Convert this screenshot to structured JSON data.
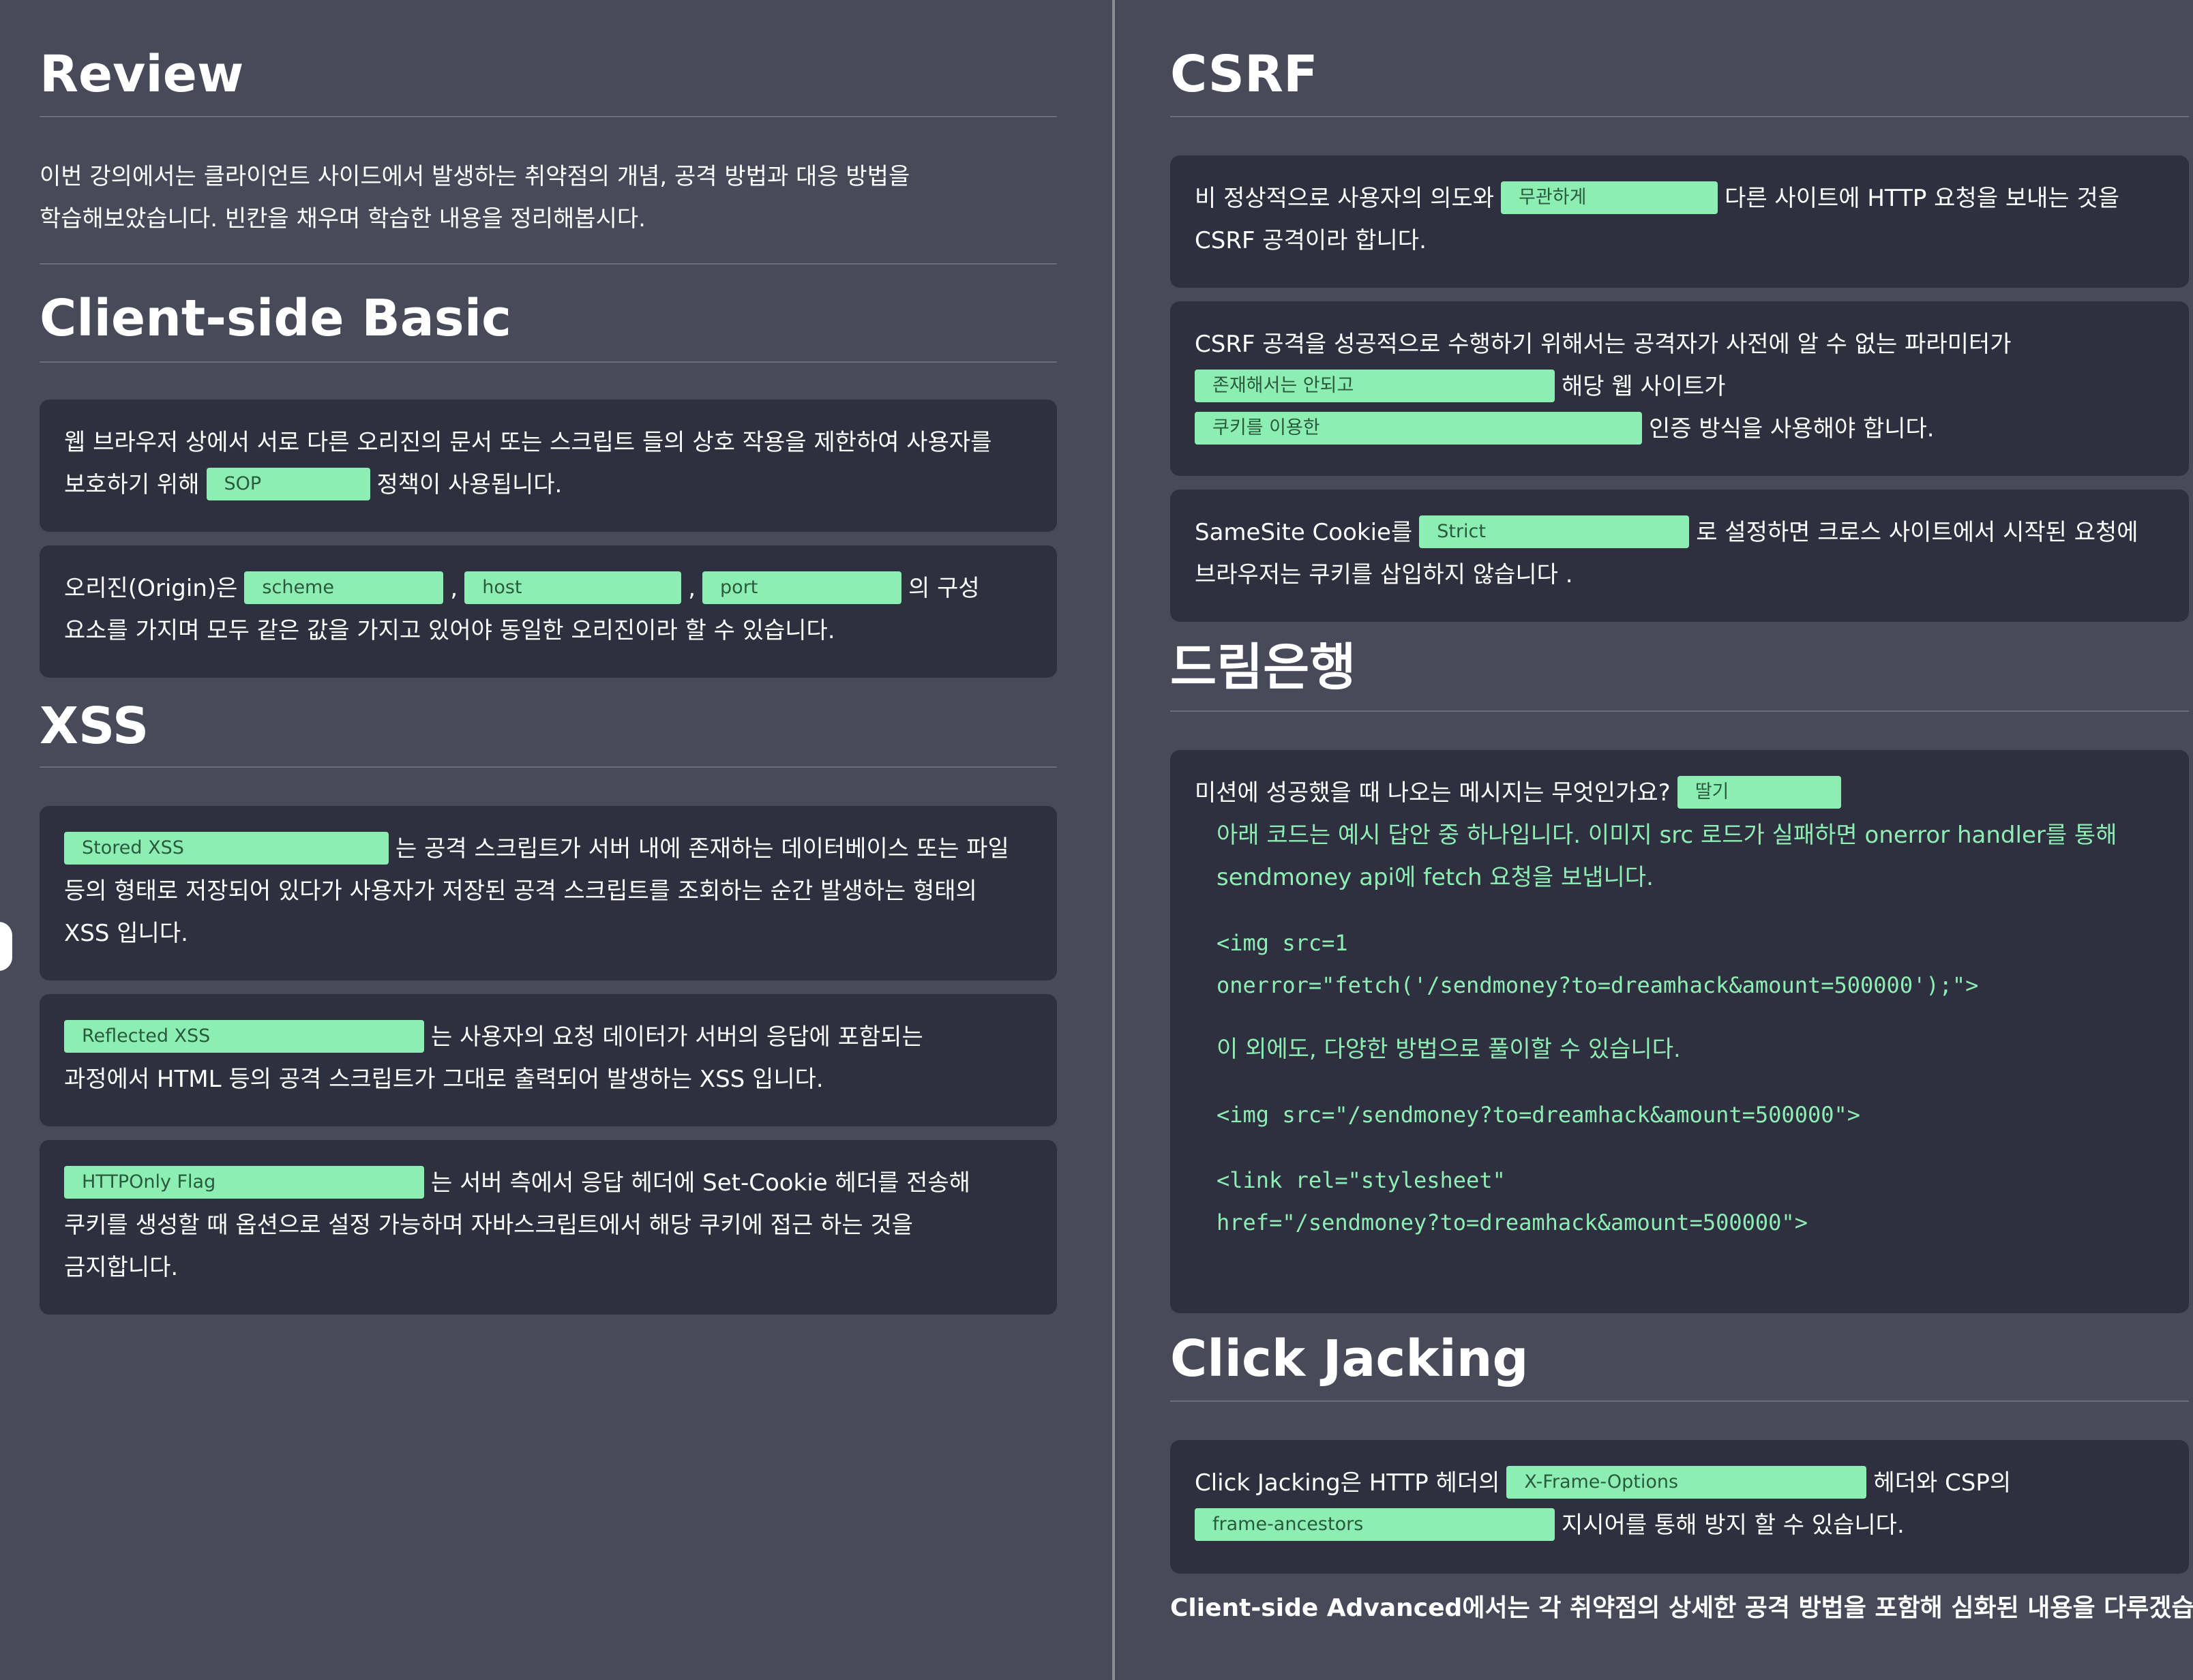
{
  "review": {
    "title": "Review",
    "intro_1": "이번 강의에서는 클라이언트 사이드에서 발생하는 취약점의 개념, 공격 방법과 대응 방법을",
    "intro_2": "학습해보았습니다. 빈칸을 채우며 학습한 내용을 정리해봅시다."
  },
  "client_side_basic": {
    "title": "Client-side Basic",
    "q1": {
      "text_1": "웹 브라우저 상에서 서로 다른 오리진의 문서 또는 스크립트 들의 상호 작용을 제한하여 사용자를",
      "text_2": "보호하기 위해",
      "answer": "SOP",
      "text_3": "정책이 사용됩니다."
    },
    "q2": {
      "text_1": "오리진(Origin)은",
      "answer_1": "scheme",
      "sep_1": ",",
      "answer_2": "host",
      "sep_2": ",",
      "answer_3": "port",
      "text_2": "의 구성",
      "text_3": "요소를 가지며 모두 같은 값을 가지고 있어야 동일한 오리진이라 할 수 있습니다."
    }
  },
  "xss": {
    "title": "XSS",
    "q1": {
      "answer": "Stored XSS",
      "text_1": "는 공격 스크립트가 서버 내에 존재하는 데이터베이스 또는 파일",
      "text_2": "등의 형태로 저장되어 있다가 사용자가 저장된 공격 스크립트를 조회하는 순간 발생하는 형태의",
      "text_3": "XSS 입니다."
    },
    "q2": {
      "answer": "Reflected XSS",
      "text_1": "는 사용자의 요청 데이터가 서버의 응답에 포함되는",
      "text_2": "과정에서 HTML 등의 공격 스크립트가 그대로 출력되어 발생하는 XSS 입니다."
    },
    "q3": {
      "answer": "HTTPOnly Flag",
      "text_1": "는 서버 측에서 응답 헤더에 Set-Cookie 헤더를 전송해",
      "text_2": "쿠키를 생성할 때 옵션으로 설정 가능하며 자바스크립트에서 해당 쿠키에 접근 하는 것을",
      "text_3": "금지합니다."
    }
  },
  "csrf": {
    "title": "CSRF",
    "q1": {
      "text_1": "비 정상적으로 사용자의 의도와",
      "answer": "무관하게",
      "text_2": "다른 사이트에 HTTP 요청을 보내는 것을",
      "text_3": "CSRF 공격이라 합니다."
    },
    "q2": {
      "text_1": "CSRF 공격을 성공적으로 수행하기 위해서는 공격자가 사전에 알 수 없는 파라미터가",
      "answer_1": "존재해서는 안되고",
      "text_2": "해당 웹 사이트가",
      "answer_2": "쿠키를 이용한",
      "text_3": "인증 방식을 사용해야 합니다."
    },
    "q3": {
      "text_1": "SameSite Cookie를",
      "answer": "Strict",
      "text_2": "로 설정하면 크로스 사이트에서 시작된 요청에",
      "text_3": "브라우저는 쿠키를 삽입하지 않습니다 ."
    }
  },
  "dreambank": {
    "title": "드림은행",
    "question": "미션에 성공했을 때 나오는 메시지는 무엇인가요?",
    "answer": "딸기",
    "explain_1": "아래 코드는 예시 답안 중 하나입니다. 이미지 src 로드가 실패하면 onerror handler를 통해",
    "explain_2": "sendmoney api에 fetch 요청을 보냅니다.",
    "code_1a": "<img src=1",
    "code_1b": "onerror=\"fetch('/sendmoney?to=dreamhack&amount=500000');\">",
    "explain_3": "이 외에도, 다양한 방법으로 풀이할 수 있습니다.",
    "code_2": "<img src=\"/sendmoney?to=dreamhack&amount=500000\">",
    "code_3a": "<link rel=\"stylesheet\"",
    "code_3b": "href=\"/sendmoney?to=dreamhack&amount=500000\">"
  },
  "click_jacking": {
    "title": "Click Jacking",
    "q1": {
      "text_1": "Click Jacking은 HTTP 헤더의",
      "answer_1": "X-Frame-Options",
      "text_2": "헤더와 CSP의",
      "answer_2": "frame-ancestors",
      "text_3": "지시어를 통해 방지 할 수 있습니다."
    }
  },
  "footer": {
    "note": "Client-side Advanced에서는 각 취약점의 상세한 공격 방법을 포함해 심화된 내용을 다루겠습니다."
  }
}
